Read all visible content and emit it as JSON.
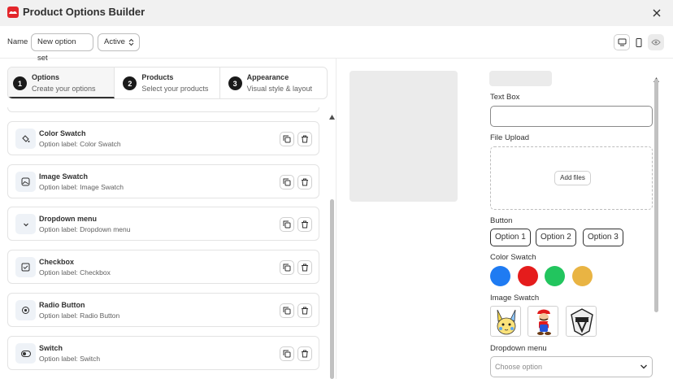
{
  "header": {
    "title": "Product Options Builder",
    "logo": "brand-logo-icon",
    "close": "close-icon"
  },
  "toolbar": {
    "name_label": "Name",
    "name_value": "New option set",
    "status_value": "Active"
  },
  "steps": [
    {
      "number": "1",
      "title": "Options",
      "subtitle": "Create your options"
    },
    {
      "number": "2",
      "title": "Products",
      "subtitle": "Select your products"
    },
    {
      "number": "3",
      "title": "Appearance",
      "subtitle": "Visual style & layout"
    }
  ],
  "options": [
    {
      "title": "Color Swatch",
      "subtitle": "Option label: Color Swatch",
      "icon": "paint-bucket-icon"
    },
    {
      "title": "Image Swatch",
      "subtitle": "Option label: Image Swatch",
      "icon": "image-icon"
    },
    {
      "title": "Dropdown menu",
      "subtitle": "Option label: Dropdown menu",
      "icon": "chevron-down-icon"
    },
    {
      "title": "Checkbox",
      "subtitle": "Option label: Checkbox",
      "icon": "checkbox-icon"
    },
    {
      "title": "Radio Button",
      "subtitle": "Option label: Radio Button",
      "icon": "radio-icon"
    },
    {
      "title": "Switch",
      "subtitle": "Option label: Switch",
      "icon": "toggle-icon"
    }
  ],
  "preview": {
    "text_box_label": "Text Box",
    "file_upload_label": "File Upload",
    "add_files": "Add files",
    "button_label": "Button",
    "buttons": [
      "Option 1",
      "Option 2",
      "Option 3"
    ],
    "color_swatch_label": "Color Swatch",
    "colors": [
      "#1f7bf2",
      "#e51c1c",
      "#22c55e",
      "#e9b443"
    ],
    "image_swatch_label": "Image Swatch",
    "images": [
      "pikachu-like-character-image",
      "mario-character-image",
      "gta-v-logo-image"
    ],
    "dropdown_label": "Dropdown menu",
    "dropdown_placeholder": "Choose option"
  }
}
